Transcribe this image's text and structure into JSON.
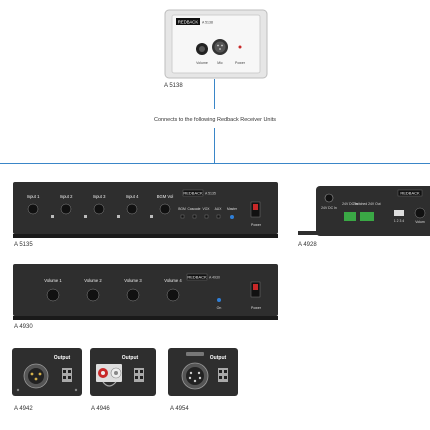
{
  "wallplate": {
    "model": "A 5138",
    "brand_badge": "REDBACK",
    "plate_code": "A 5138",
    "labels": {
      "volume": "Volume",
      "mic": "Mic",
      "power": "Power"
    }
  },
  "connects_text": "Connects to the following Redback Receiver Units",
  "units": {
    "a5135": {
      "model": "A 5135",
      "brand": "REDBACK",
      "subtitle": "A 5135",
      "inputs": [
        "Input 1",
        "Input 2",
        "Input 3",
        "Input 4"
      ],
      "bgm_vol": "BGM Vol",
      "selector_labels": [
        "BGM",
        "Cascade",
        "VOX",
        "AUX",
        "Master"
      ],
      "power": "Power"
    },
    "a4928": {
      "model": "A 4928",
      "brand": "REDBACK",
      "labels": [
        "24V DC In",
        "24V DC In",
        "Switched 24V Out"
      ],
      "dip_numbers": "1 2 3 4",
      "volume": "Volum"
    },
    "a4930": {
      "model": "A 4930",
      "brand": "REDBACK",
      "subtitle": "A 4930",
      "volumes": [
        "Volume 1",
        "Volume 2",
        "Volume 3",
        "Volume 4"
      ],
      "on": "On",
      "power": "Power"
    },
    "a4942": {
      "model": "A 4942",
      "output": "Output"
    },
    "a4946": {
      "model": "A 4946",
      "output": "Output"
    },
    "a4954": {
      "model": "A 4954",
      "output": "Output"
    }
  },
  "colors": {
    "line": "#3a86c8",
    "panel": "#2e2e2e",
    "led": "#2f7fd8",
    "power_red": "#c82828",
    "terminal_green": "#3aa845"
  }
}
